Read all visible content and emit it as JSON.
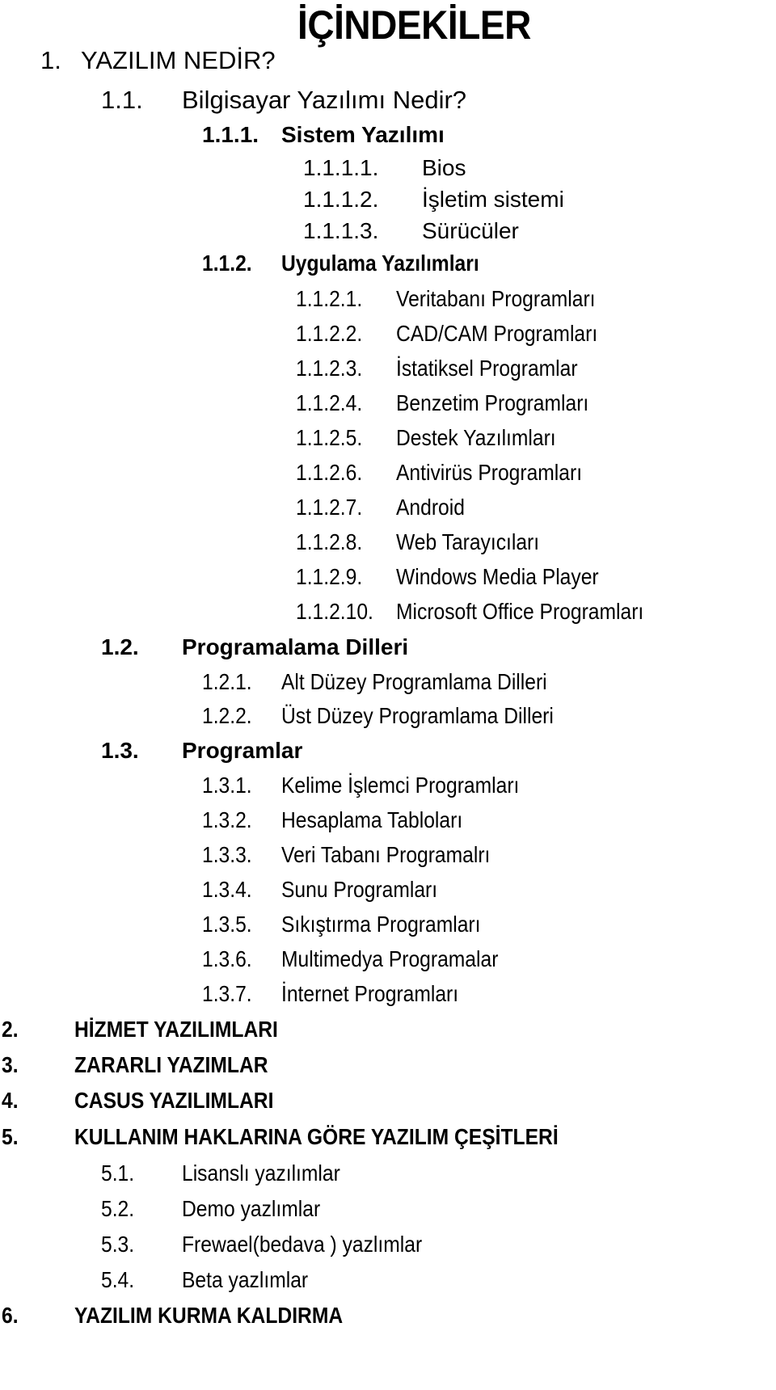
{
  "title": "İÇİNDEKİLER",
  "entries": [
    {
      "num": "1.",
      "text": "YAZILIM NEDİR?"
    },
    {
      "num": "1.1.",
      "text": "Bilgisayar Yazılımı Nedir?"
    },
    {
      "num": "1.1.1.",
      "text": "Sistem Yazılımı"
    },
    {
      "num": "1.1.1.1.",
      "text": "Bios"
    },
    {
      "num": "1.1.1.2.",
      "text": "İşletim sistemi"
    },
    {
      "num": "1.1.1.3.",
      "text": "Sürücüler"
    },
    {
      "num": "1.1.2.",
      "text": "Uygulama Yazılımları"
    },
    {
      "num": "1.1.2.1.",
      "text": "Veritabanı Programları"
    },
    {
      "num": "1.1.2.2.",
      "text": "CAD/CAM Programları"
    },
    {
      "num": "1.1.2.3.",
      "text": "İstatiksel Programlar"
    },
    {
      "num": "1.1.2.4.",
      "text": "Benzetim Programları"
    },
    {
      "num": "1.1.2.5.",
      "text": "Destek Yazılımları"
    },
    {
      "num": "1.1.2.6.",
      "text": "Antivirüs Programları"
    },
    {
      "num": "1.1.2.7.",
      "text": "Android"
    },
    {
      "num": "1.1.2.8.",
      "text": "Web Tarayıcıları"
    },
    {
      "num": "1.1.2.9.",
      "text": "Windows Media Player"
    },
    {
      "num": "1.1.2.10.",
      "text": "Microsoft Office Programları"
    },
    {
      "num": "1.2.",
      "text": "Programalama Dilleri"
    },
    {
      "num": "1.2.1.",
      "text": "Alt Düzey Programlama Dilleri"
    },
    {
      "num": "1.2.2.",
      "text": "Üst Düzey Programlama Dilleri"
    },
    {
      "num": "1.3.",
      "text": "Programlar"
    },
    {
      "num": "1.3.1.",
      "text": "Kelime İşlemci Programları"
    },
    {
      "num": "1.3.2.",
      "text": "Hesaplama Tabloları"
    },
    {
      "num": "1.3.3.",
      "text": "Veri Tabanı Programalrı"
    },
    {
      "num": "1.3.4.",
      "text": "Sunu Programları"
    },
    {
      "num": "1.3.5.",
      "text": "Sıkıştırma Programları"
    },
    {
      "num": "1.3.6.",
      "text": "Multimedya Programalar"
    },
    {
      "num": "1.3.7.",
      "text": "İnternet Programları"
    },
    {
      "num": "2.",
      "text": "HİZMET YAZILIMLARI"
    },
    {
      "num": "3.",
      "text": "ZARARLI YAZIMLAR"
    },
    {
      "num": "4.",
      "text": "CASUS YAZILIMLARI"
    },
    {
      "num": "5.",
      "text": "KULLANIM HAKLARINA GÖRE YAZILIM ÇEŞİTLERİ"
    },
    {
      "num": "5.1.",
      "text": "Lisanslı yazılımlar"
    },
    {
      "num": "5.2.",
      "text": "Demo yazlımlar"
    },
    {
      "num": "5.3.",
      "text": "Frewael(bedava ) yazlımlar"
    },
    {
      "num": "5.4.",
      "text": "Beta yazlımlar"
    },
    {
      "num": "6.",
      "text": "YAZILIM KURMA KALDIRMA"
    }
  ]
}
